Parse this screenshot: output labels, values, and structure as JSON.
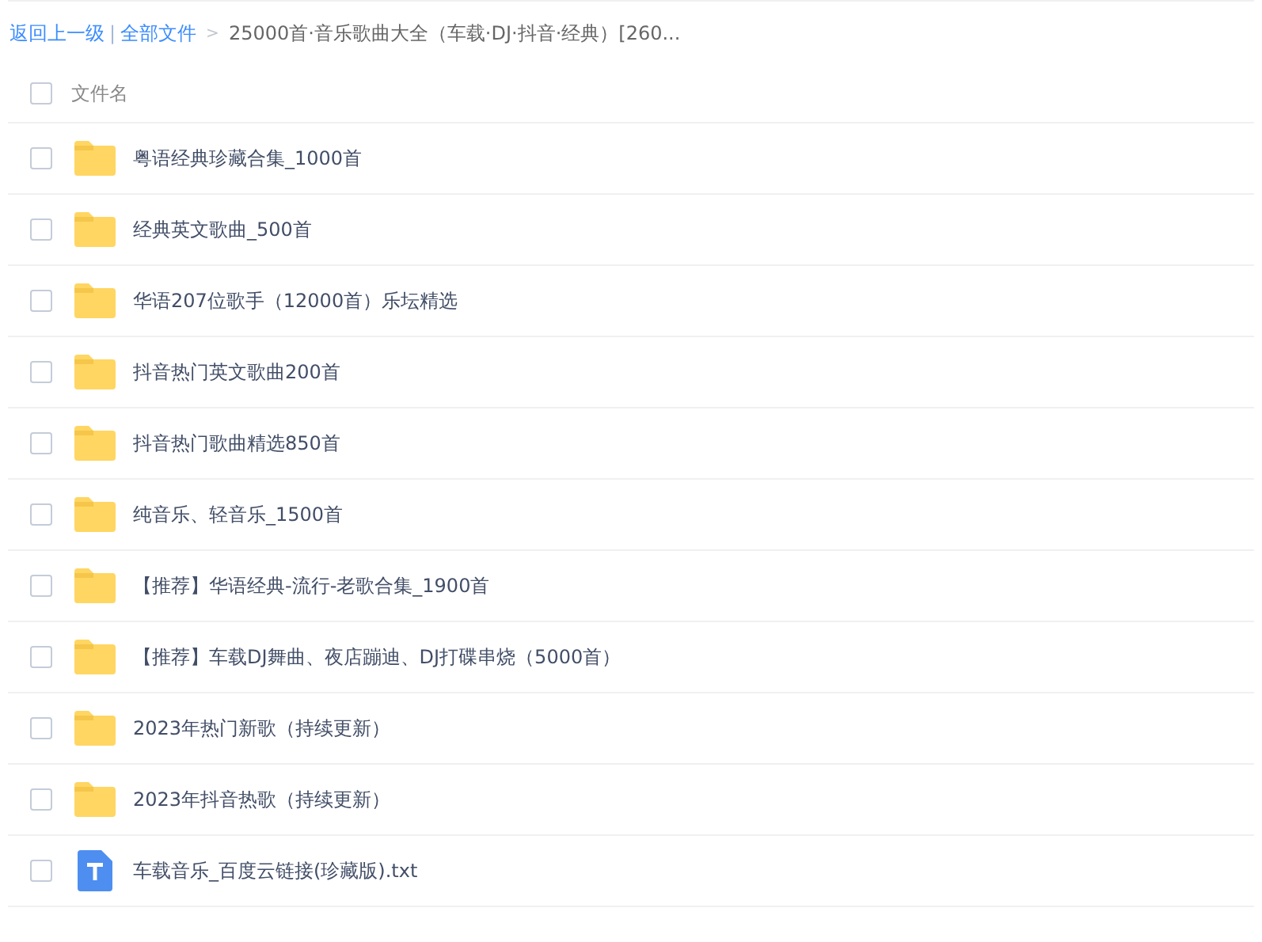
{
  "breadcrumb": {
    "back_link": "返回上一级",
    "divider": "|",
    "root_link": "全部文件",
    "arrow": ">",
    "current": "25000首·音乐歌曲大全（车载·DJ·抖音·经典）[260..."
  },
  "header": {
    "checked": false,
    "label": "文件名"
  },
  "files": [
    {
      "kind": "folder",
      "name": "粤语经典珍藏合集_1000首",
      "checked": false
    },
    {
      "kind": "folder",
      "name": "经典英文歌曲_500首",
      "checked": false
    },
    {
      "kind": "folder",
      "name": "华语207位歌手（12000首）乐坛精选",
      "checked": false
    },
    {
      "kind": "folder",
      "name": "抖音热门英文歌曲200首",
      "checked": false
    },
    {
      "kind": "folder",
      "name": "抖音热门歌曲精选850首",
      "checked": false
    },
    {
      "kind": "folder",
      "name": "纯音乐、轻音乐_1500首",
      "checked": false
    },
    {
      "kind": "folder",
      "name": "【推荐】华语经典-流行-老歌合集_1900首",
      "checked": false
    },
    {
      "kind": "folder",
      "name": "【推荐】车载DJ舞曲、夜店蹦迪、DJ打碟串烧（5000首）",
      "checked": false
    },
    {
      "kind": "folder",
      "name": "2023年热门新歌（持续更新）",
      "checked": false
    },
    {
      "kind": "folder",
      "name": "2023年抖音热歌（持续更新）",
      "checked": false
    },
    {
      "kind": "txt",
      "name": "车载音乐_百度云链接(珍藏版).txt",
      "checked": false
    }
  ]
}
